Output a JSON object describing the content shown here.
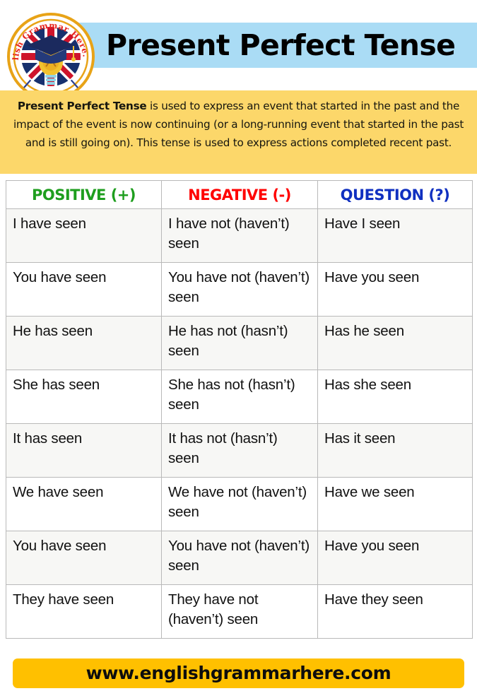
{
  "header": {
    "title": "Present Perfect Tense",
    "title_bar_color": "#aadcf5",
    "logo": {
      "name": "english-grammar-here-logo",
      "ring_text": "English Grammar Here.Com",
      "ring_color": "#e8a317",
      "text_color": "#e8251e"
    }
  },
  "description": {
    "lead": "Present Perfect Tense",
    "body": " is used to express an event that started in the past and the impact of the event is now continuing (or a long-running event that started in the past and is still going on). This tense is used to express actions completed recent past.",
    "background_color": "#fcd76a"
  },
  "table": {
    "headers": [
      {
        "label": "POSITIVE (+)",
        "color": "#1e9e1e"
      },
      {
        "label": "NEGATIVE (-)",
        "color": "#ff0000"
      },
      {
        "label": "QUESTION (?)",
        "color": "#1030c0"
      }
    ],
    "rows": [
      {
        "positive": "I have seen",
        "negative": "I have not (haven’t) seen",
        "question": "Have I seen"
      },
      {
        "positive": "You have seen",
        "negative": "You have not (haven’t) seen",
        "question": "Have you seen"
      },
      {
        "positive": "He has seen",
        "negative": "He has not (hasn’t) seen",
        "question": "Has he seen"
      },
      {
        "positive": "She has seen",
        "negative": "She has not (hasn’t) seen",
        "question": "Has she seen"
      },
      {
        "positive": "It has seen",
        "negative": "It has not (hasn’t) seen",
        "question": "Has it seen"
      },
      {
        "positive": "We have seen",
        "negative": "We have not (haven’t) seen",
        "question": "Have we seen"
      },
      {
        "positive": "You have seen",
        "negative": "You have not (haven’t) seen",
        "question": "Have you seen"
      },
      {
        "positive": "They have seen",
        "negative": "They have not (haven’t) seen",
        "question": "Have they seen"
      }
    ]
  },
  "footer": {
    "url": "www.englishgrammarhere.com",
    "background_color": "#ffc000"
  }
}
